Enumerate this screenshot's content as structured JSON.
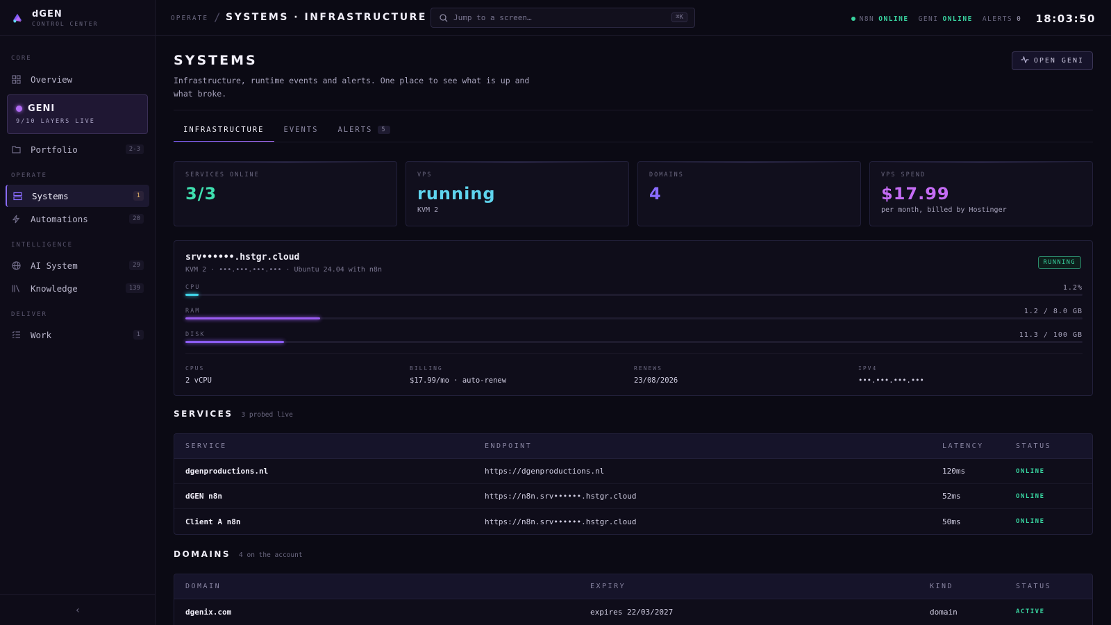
{
  "brand": {
    "name": "dGEN",
    "subtitle": "CONTROL CENTER"
  },
  "sidebar": {
    "sections": {
      "core": "CORE",
      "operate": "OPERATE",
      "intelligence": "INTELLIGENCE",
      "deliver": "DELIVER"
    },
    "overview": {
      "label": "Overview",
      "icon": "grid-icon"
    },
    "geni": {
      "title": "GENI",
      "subtitle": "9/10 LAYERS LIVE"
    },
    "portfolio": {
      "label": "Portfolio",
      "count": "2-3",
      "icon": "folder-icon"
    },
    "systems": {
      "label": "Systems",
      "count": "1",
      "icon": "server-icon"
    },
    "automations": {
      "label": "Automations",
      "count": "20",
      "icon": "bolt-icon"
    },
    "ai_system": {
      "label": "AI System",
      "count": "29",
      "icon": "globe-icon"
    },
    "knowledge": {
      "label": "Knowledge",
      "count": "139",
      "icon": "library-icon"
    },
    "work": {
      "label": "Work",
      "count": "1",
      "icon": "checklist-icon"
    },
    "collapse": "‹"
  },
  "topbar": {
    "crumb_parent": "OPERATE",
    "crumb_sep": "/",
    "crumb_current": "SYSTEMS · INFRASTRUCTURE",
    "search_placeholder": "Jump to a screen…",
    "search_shortcut": "⌘K",
    "status": {
      "n8n_label": "N8N",
      "n8n_value": "ONLINE",
      "geni_label": "GENI",
      "geni_value": "ONLINE",
      "alerts_label": "ALERTS",
      "alerts_value": "0"
    },
    "clock": "18:03:50"
  },
  "page": {
    "title": "SYSTEMS",
    "description": "Infrastructure, runtime events and alerts. One place to see what is up and what broke.",
    "open_geni": "OPEN GENI"
  },
  "tabs": [
    {
      "label": "INFRASTRUCTURE"
    },
    {
      "label": "EVENTS"
    },
    {
      "label": "ALERTS",
      "badge": "5"
    }
  ],
  "stats": {
    "services": {
      "label": "SERVICES ONLINE",
      "value": "3/3",
      "color": "#3fe0b0"
    },
    "vps": {
      "label": "VPS",
      "value": "running",
      "sub": "KVM 2",
      "color": "#5fd4ee"
    },
    "domains": {
      "label": "DOMAINS",
      "value": "4",
      "color": "#8a6cff"
    },
    "spend": {
      "label": "VPS SPEND",
      "value": "$17.99",
      "sub": "per month, billed by Hostinger",
      "color": "#c56cf5"
    }
  },
  "vps": {
    "host": "srv••••••.hstgr.cloud",
    "meta": "KVM 2 · •••.•••.•••.••• · Ubuntu 24.04 with n8n",
    "status": "RUNNING",
    "cpu": {
      "label": "CPU",
      "value": "1.2%",
      "fraction": 0.015,
      "color": "#3fd4e8"
    },
    "ram": {
      "label": "RAM",
      "value": "1.2 / 8.0 GB",
      "fraction": 0.15,
      "color": "#9a5cf0"
    },
    "disk": {
      "label": "DISK",
      "value": "11.3 / 100 GB",
      "fraction": 0.11,
      "color": "#8a5cf0"
    },
    "cpus": {
      "label": "CPUS",
      "value": "2 vCPU"
    },
    "billing": {
      "label": "BILLING",
      "value": "$17.99/mo · auto-renew"
    },
    "renews": {
      "label": "RENEWS",
      "value": "23/08/2026"
    },
    "ipv4": {
      "label": "IPV4",
      "value": "•••.•••.•••.•••"
    }
  },
  "services": {
    "title": "SERVICES",
    "subtitle": "3 probed live",
    "headers": {
      "service": "SERVICE",
      "endpoint": "ENDPOINT",
      "latency": "LATENCY",
      "status": "STATUS"
    },
    "rows": [
      {
        "service": "dgenproductions.nl",
        "endpoint": "https://dgenproductions.nl",
        "latency": "120ms",
        "status": "ONLINE"
      },
      {
        "service": "dGEN n8n",
        "endpoint": "https://n8n.srv••••••.hstgr.cloud",
        "latency": "52ms",
        "status": "ONLINE"
      },
      {
        "service": "Client A n8n",
        "endpoint": "https://n8n.srv••••••.hstgr.cloud",
        "latency": "50ms",
        "status": "ONLINE"
      }
    ]
  },
  "domains": {
    "title": "DOMAINS",
    "subtitle": "4 on the account",
    "headers": {
      "domain": "DOMAIN",
      "expiry": "EXPIRY",
      "kind": "KIND",
      "status": "STATUS"
    },
    "rows": [
      {
        "domain": "dgenix.com",
        "expiry": "expires 22/03/2027",
        "kind": "domain",
        "status": "ACTIVE"
      }
    ]
  }
}
